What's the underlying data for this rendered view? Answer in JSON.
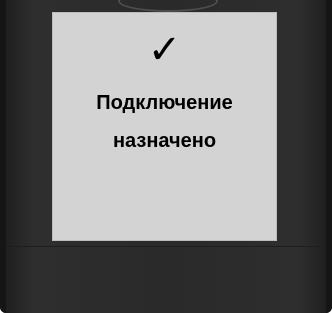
{
  "icon": {
    "name": "checkmark-icon",
    "glyph": "✓"
  },
  "message": {
    "line1": "Подключение",
    "line2": "назначено"
  },
  "colors": {
    "device_body": "#2a2a2a",
    "screen_bg": "#d3d3d3",
    "text": "#000000"
  }
}
